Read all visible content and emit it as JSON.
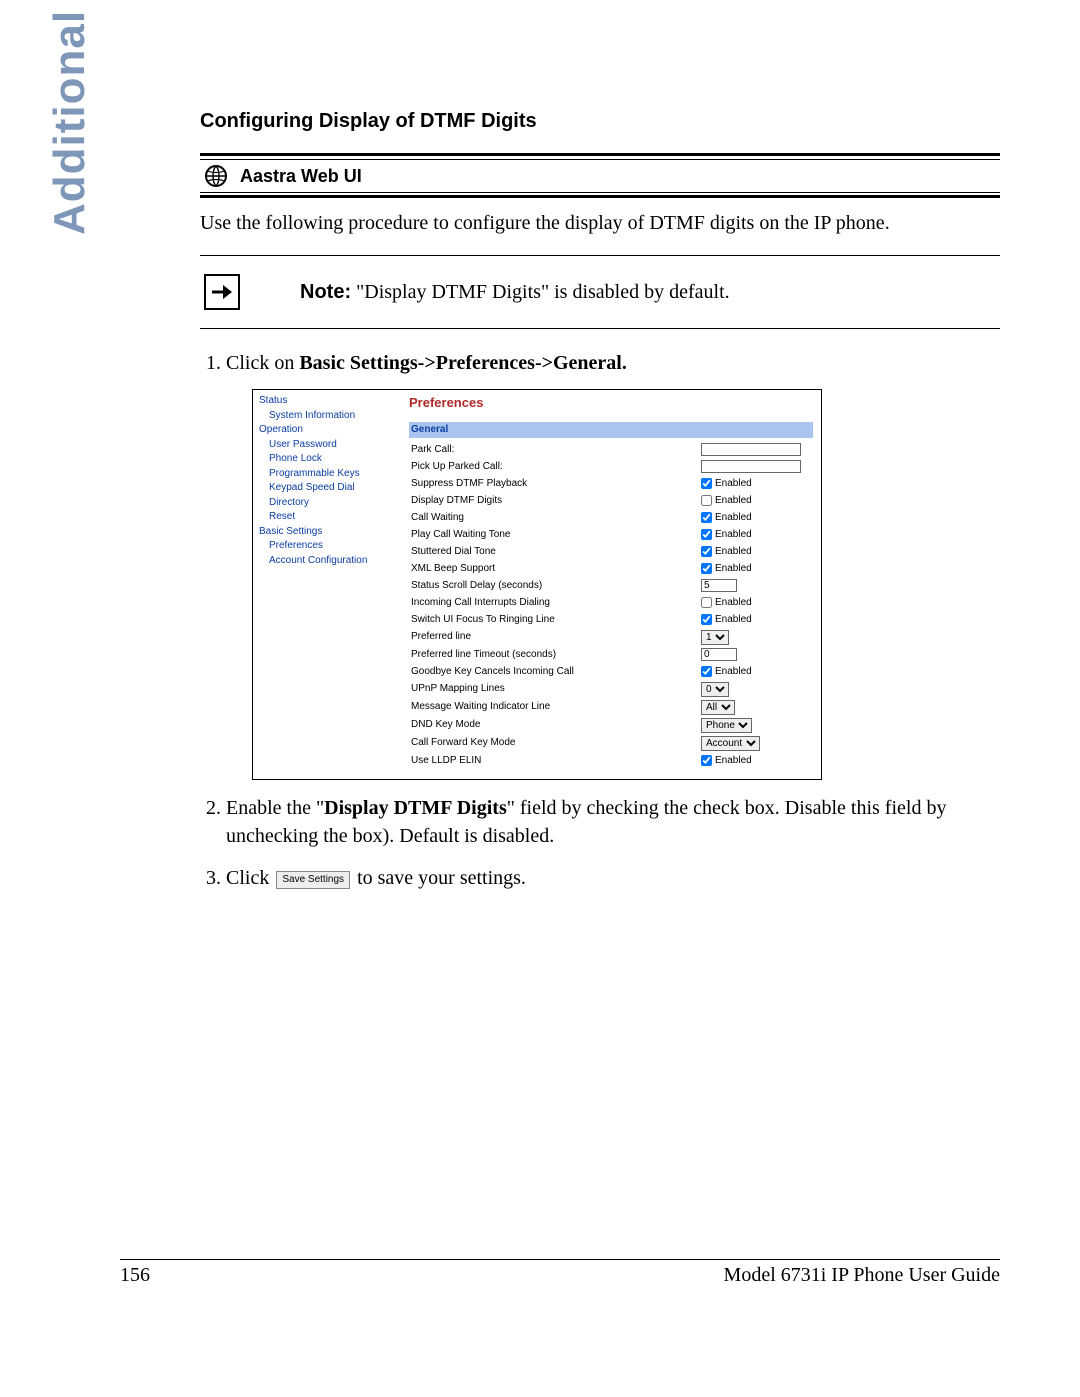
{
  "sideLabel": "Additional Features",
  "heading": "Configuring Display of DTMF Digits",
  "aastraLabel": "Aastra Web UI",
  "intro": "Use the following procedure to configure the display of DTMF digits on the IP phone.",
  "noteLabel": "Note:",
  "noteText": " \"Display DTMF Digits\" is disabled by default.",
  "step1_pre": "Click on ",
  "step1_bold": "Basic Settings->Preferences->General.",
  "step2_a": "Enable the \"",
  "step2_bold": "Display DTMF Digits",
  "step2_b": "\" field by checking the check box. Disable this field by unchecking the box). Default is disabled.",
  "step3_a": "Click ",
  "step3_btn": "Save Settings",
  "step3_b": " to save your settings.",
  "webui": {
    "title": "Preferences",
    "general": "General",
    "nav": {
      "status": "Status",
      "sysinfo": "System Information",
      "operation": "Operation",
      "userpw": "User Password",
      "phonelock": "Phone Lock",
      "progkeys": "Programmable Keys",
      "keypad": "Keypad Speed Dial",
      "directory": "Directory",
      "reset": "Reset",
      "basic": "Basic Settings",
      "prefs": "Preferences",
      "acct": "Account Configuration"
    },
    "rows": [
      {
        "label": "Park Call:",
        "type": "text",
        "value": ""
      },
      {
        "label": "Pick Up Parked Call:",
        "type": "text",
        "value": ""
      },
      {
        "label": "Suppress DTMF Playback",
        "type": "check",
        "checked": true,
        "text": "Enabled"
      },
      {
        "label": "Display DTMF Digits",
        "type": "check",
        "checked": false,
        "text": "Enabled"
      },
      {
        "label": "Call Waiting",
        "type": "check",
        "checked": true,
        "text": "Enabled"
      },
      {
        "label": "Play Call Waiting Tone",
        "type": "check",
        "checked": true,
        "text": "Enabled"
      },
      {
        "label": "Stuttered Dial Tone",
        "type": "check",
        "checked": true,
        "text": "Enabled"
      },
      {
        "label": "XML Beep Support",
        "type": "check",
        "checked": true,
        "text": "Enabled"
      },
      {
        "label": "Status Scroll Delay (seconds)",
        "type": "text",
        "value": "5",
        "short": true
      },
      {
        "label": "Incoming Call Interrupts Dialing",
        "type": "check",
        "checked": false,
        "text": "Enabled"
      },
      {
        "label": "Switch UI Focus To Ringing Line",
        "type": "check",
        "checked": true,
        "text": "Enabled"
      },
      {
        "label": "Preferred line",
        "type": "select",
        "value": "1"
      },
      {
        "label": "Preferred line Timeout (seconds)",
        "type": "text",
        "value": "0",
        "short": true
      },
      {
        "label": "Goodbye Key Cancels Incoming Call",
        "type": "check",
        "checked": true,
        "text": "Enabled"
      },
      {
        "label": "UPnP Mapping Lines",
        "type": "select",
        "value": "0"
      },
      {
        "label": "Message Waiting Indicator Line",
        "type": "select",
        "value": "All"
      },
      {
        "label": "DND Key Mode",
        "type": "select",
        "value": "Phone"
      },
      {
        "label": "Call Forward Key Mode",
        "type": "select",
        "value": "Account"
      },
      {
        "label": "Use LLDP ELIN",
        "type": "check",
        "checked": true,
        "text": "Enabled"
      }
    ]
  },
  "footer": {
    "page": "156",
    "guide": "Model 6731i IP Phone User Guide"
  }
}
